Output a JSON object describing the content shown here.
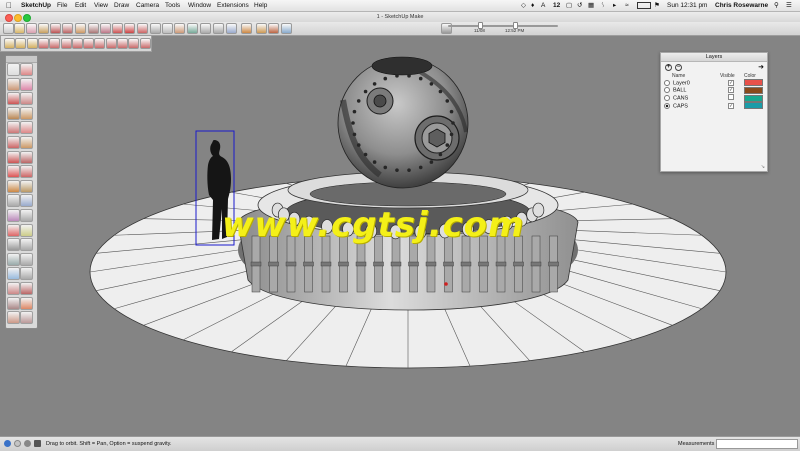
{
  "menubar": {
    "app": "SketchUp",
    "items": [
      "File",
      "Edit",
      "View",
      "Draw",
      "Camera",
      "Tools",
      "Window",
      "Extensions",
      "Help"
    ],
    "input_badge": "12",
    "clock": "Sun 12:31 pm",
    "user": "Chris Rosewarne"
  },
  "window": {
    "title": "1 - SketchUp Make"
  },
  "toolbar": {
    "date_label": "11/08",
    "time_label": "12:52 PM"
  },
  "layers_panel": {
    "title": "Layers",
    "add_label": "+",
    "remove_label": "−",
    "details_label": "➜",
    "columns": {
      "name": "Name",
      "visible": "Visible",
      "color": "Color"
    },
    "rows": [
      {
        "name": "Layer0",
        "visible": "✓",
        "color": "#e8514a",
        "active": false
      },
      {
        "name": "BALL",
        "visible": "✓",
        "color": "#8a4a1c",
        "active": false
      },
      {
        "name": "CANS",
        "visible": "",
        "color": "#18a890",
        "active": false
      },
      {
        "name": "CAPS",
        "visible": "✓",
        "color": "#1a9ca8",
        "active": true
      }
    ]
  },
  "statusbar": {
    "hint": "Drag to orbit. Shift = Pan, Option = suspend gravity.",
    "measurements_label": "Measurements",
    "measurements_value": ""
  },
  "watermark": {
    "text": "www.cgtsj.com"
  },
  "colors": {
    "viewport_bg": "#848484",
    "ground_disk": "#f0f0f0",
    "selection_blue": "#1a1acc",
    "watermark": "#f4f018"
  }
}
